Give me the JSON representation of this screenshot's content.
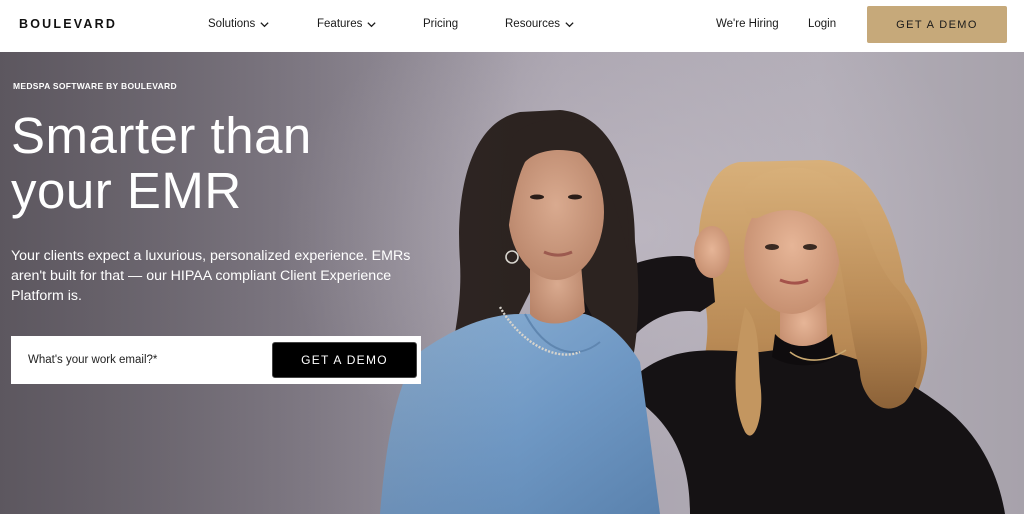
{
  "brand": {
    "logo_text": "BOULEVARD"
  },
  "nav": {
    "items": [
      {
        "label": "Solutions",
        "has_dropdown": true
      },
      {
        "label": "Features",
        "has_dropdown": true
      },
      {
        "label": "Pricing",
        "has_dropdown": false
      },
      {
        "label": "Resources",
        "has_dropdown": true
      }
    ],
    "hiring_label": "We're Hiring",
    "login_label": "Login",
    "cta_label": "GET A DEMO",
    "cta_color": "#c6a97a"
  },
  "hero": {
    "eyebrow": "MEDSPA SOFTWARE BY BOULEVARD",
    "headline_line1": "Smarter than",
    "headline_line2": "your EMR",
    "subcopy": "Your clients expect a luxurious, personalized experience. EMRs aren't built for that — our HIPAA compliant Client Experience Platform is.",
    "email_placeholder": "What's your work email?*",
    "form_cta_label": "GET A DEMO"
  }
}
